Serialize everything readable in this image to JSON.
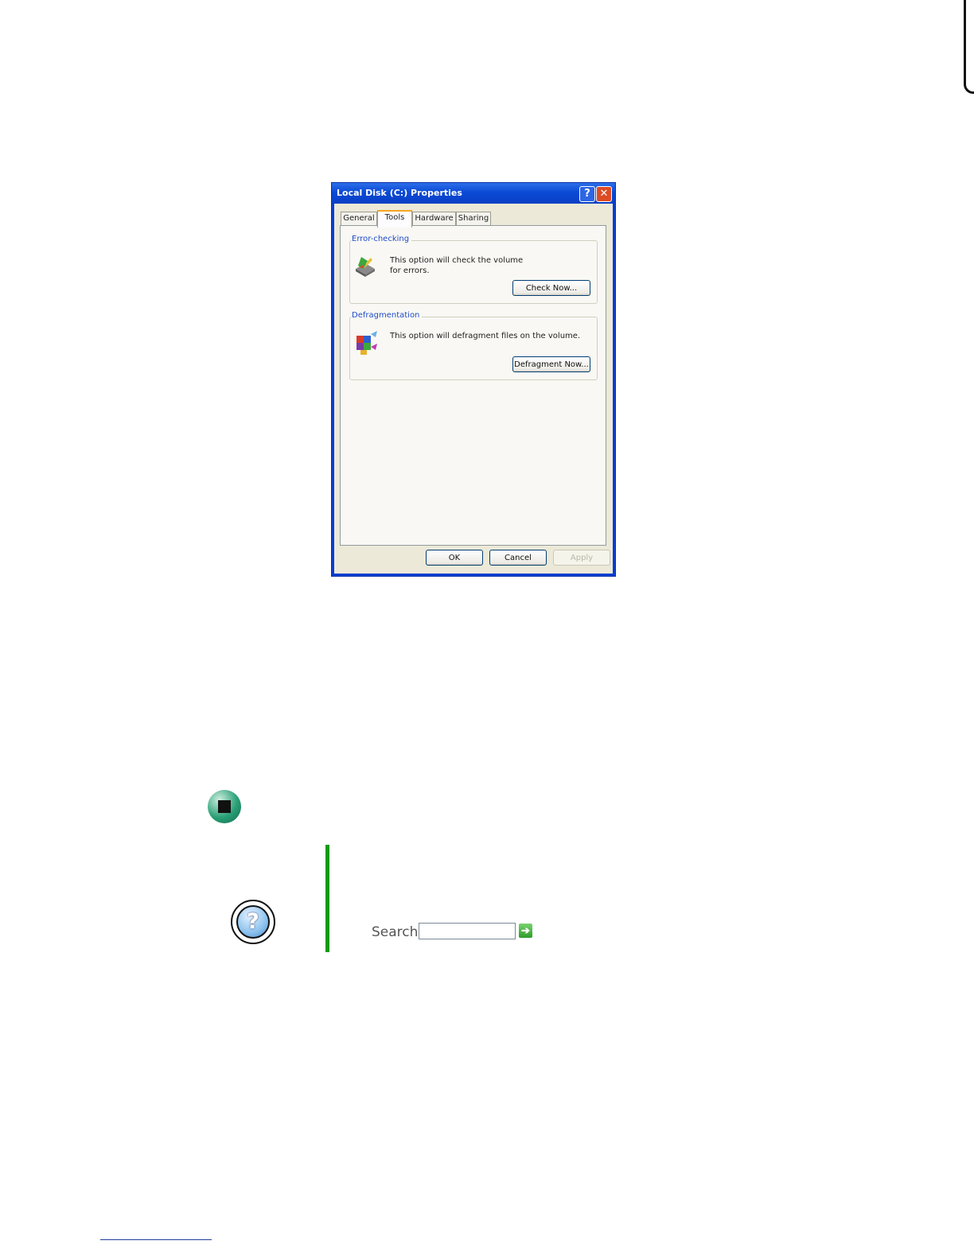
{
  "dialog": {
    "title": "Local Disk (C:) Properties",
    "help_glyph": "?",
    "close_glyph": "✕",
    "tabs": [
      {
        "label": "General"
      },
      {
        "label": "Tools"
      },
      {
        "label": "Hardware"
      },
      {
        "label": "Sharing"
      }
    ],
    "active_tab": "Tools",
    "error_checking": {
      "label": "Error-checking",
      "description": "This option will check the volume for errors.",
      "button": "Check Now..."
    },
    "defragmentation": {
      "label": "Defragmentation",
      "description": "This option will defragment files on the volume.",
      "button": "Defragment Now..."
    },
    "buttons": {
      "ok": "OK",
      "cancel": "Cancel",
      "apply": "Apply"
    }
  },
  "help_box": {
    "icon_glyph": "?",
    "search_label": "Search",
    "search_value": "",
    "go_glyph": "➔"
  },
  "colors": {
    "tip_bar": "#129a12",
    "stop_icon": "#2aa077",
    "title_bar": "#0a4ad6",
    "footer_rule": "#1f3d9c"
  }
}
